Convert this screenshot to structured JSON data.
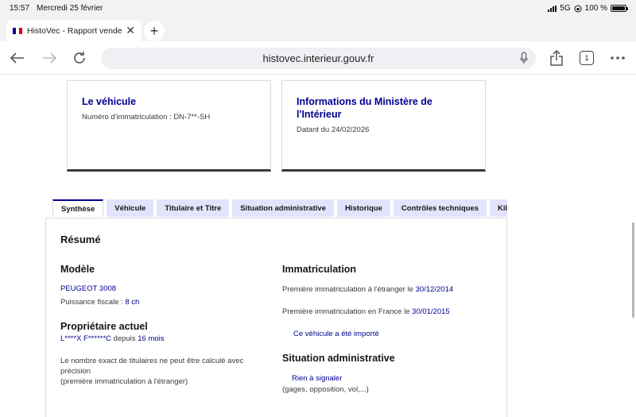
{
  "status_bar": {
    "time": "15:57",
    "date": "Mercredi 25 février",
    "network": "5G",
    "battery": "100 %"
  },
  "browser": {
    "tab_title": "HistoVec - Rapport vendeur",
    "url": "histovec.interieur.gouv.fr",
    "tab_count": "1"
  },
  "cards": {
    "vehicle": {
      "title": "Le véhicule",
      "text": "Numéro d'immatriculation : DN-7**-SH"
    },
    "ministry": {
      "title_line1": "Informations du Ministère de",
      "title_line2": "l'Intérieur",
      "text": "Datant du 24/02/2026"
    }
  },
  "tabs": [
    "Synthèse",
    "Véhicule",
    "Titulaire et Titre",
    "Situation administrative",
    "Historique",
    "Contrôles techniques",
    "Kilométrage"
  ],
  "summary": {
    "title": "Résumé",
    "model": {
      "title": "Modèle",
      "name": "PEUGEOT 3008",
      "power_label": "Puissance fiscale :",
      "power_value": "8 ch"
    },
    "owner": {
      "title": "Propriétaire actuel",
      "name": "L****X F******C",
      "since_label": "depuis",
      "since_value": "16 mois",
      "note_line1": "Le nombre exact de titulaires ne peut être calculé avec",
      "note_line2": "précision",
      "note_line3": "(première immatriculation à l'étranger)"
    },
    "registration": {
      "title": "Immatriculation",
      "foreign_label": "Première immatriculation à l'étranger le",
      "foreign_date": "30/12/2014",
      "france_label": "Première immatriculation en France le",
      "france_date": "30/01/2015",
      "imported": "Ce véhicule a été importé"
    },
    "admin": {
      "title": "Situation administrative",
      "status": "Rien à signaler",
      "details": "(gages, opposition, vol,...)"
    }
  },
  "colors": {
    "accent": "#000091",
    "tab_bg": "#e3e3fd"
  }
}
